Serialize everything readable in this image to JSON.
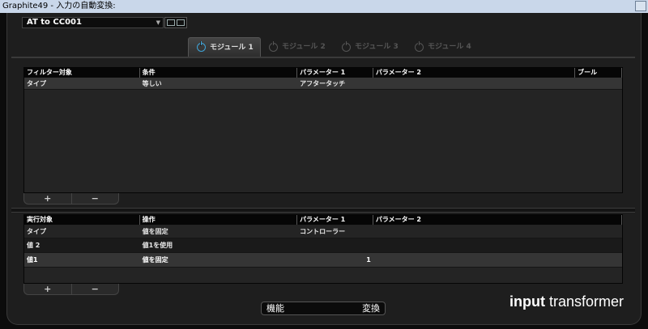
{
  "window": {
    "title": "Graphite49 - 入力の自動変換:"
  },
  "preset": {
    "name": "AT to CC001"
  },
  "tabs": [
    {
      "label": "モジュール 1",
      "active": true
    },
    {
      "label": "モジュール 2",
      "active": false
    },
    {
      "label": "モジュール 3",
      "active": false
    },
    {
      "label": "モジュール 4",
      "active": false
    }
  ],
  "filter": {
    "headers": [
      "フィルター対象",
      "条件",
      "パラメーター 1",
      "パラメーター 2",
      "ブール"
    ],
    "rows": [
      [
        "タイプ",
        "等しい",
        "アフタータッチ",
        "",
        ""
      ]
    ]
  },
  "action": {
    "headers": [
      "実行対象",
      "操作",
      "パラメーター 1",
      "パラメーター 2"
    ],
    "rows": [
      [
        "タイプ",
        "値を固定",
        "コントローラー",
        ""
      ],
      [
        "値 2",
        "値1を使用",
        "",
        ""
      ],
      [
        "値1",
        "値を固定",
        "1",
        ""
      ]
    ]
  },
  "buttons": {
    "plus": "+",
    "minus": "−"
  },
  "bottom": {
    "function_label": "機能",
    "function_value": "変換",
    "brand_bold": "input",
    "brand_rest": " transformer"
  },
  "colors": {
    "accent": "#3fa4d8"
  }
}
